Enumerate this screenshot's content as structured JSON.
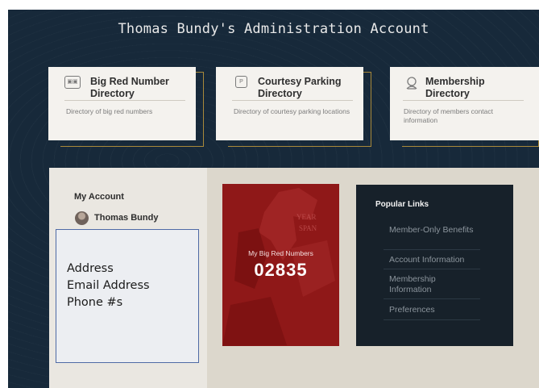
{
  "header": {
    "title": "Thomas Bundy's Administration Account"
  },
  "cards": [
    {
      "title": "Big Red Number Directory",
      "description": "Directory of big red numbers",
      "icon": "number-card-icon"
    },
    {
      "title": "Courtesy Parking Directory",
      "description": "Directory of courtesy parking locations",
      "icon": "parking-icon",
      "icon_glyph": "P"
    },
    {
      "title": "Membership Directory",
      "description": "Directory of members contact information",
      "icon": "member-icon"
    }
  ],
  "account": {
    "heading": "My Account",
    "user_name": "Thomas Bundy",
    "note_lines": [
      "Address",
      "Email Address",
      "Phone #s"
    ]
  },
  "red_card": {
    "label": "My Big Red Numbers",
    "number": "02835"
  },
  "popular_links": {
    "title": "Popular Links",
    "items": [
      "Member-Only Benefits",
      "Account Information",
      "Membership Information",
      "Preferences"
    ]
  },
  "colors": {
    "navy": "#17293a",
    "gold": "#a9893a",
    "red": "#8d1515",
    "dark_panel": "#17212a"
  }
}
